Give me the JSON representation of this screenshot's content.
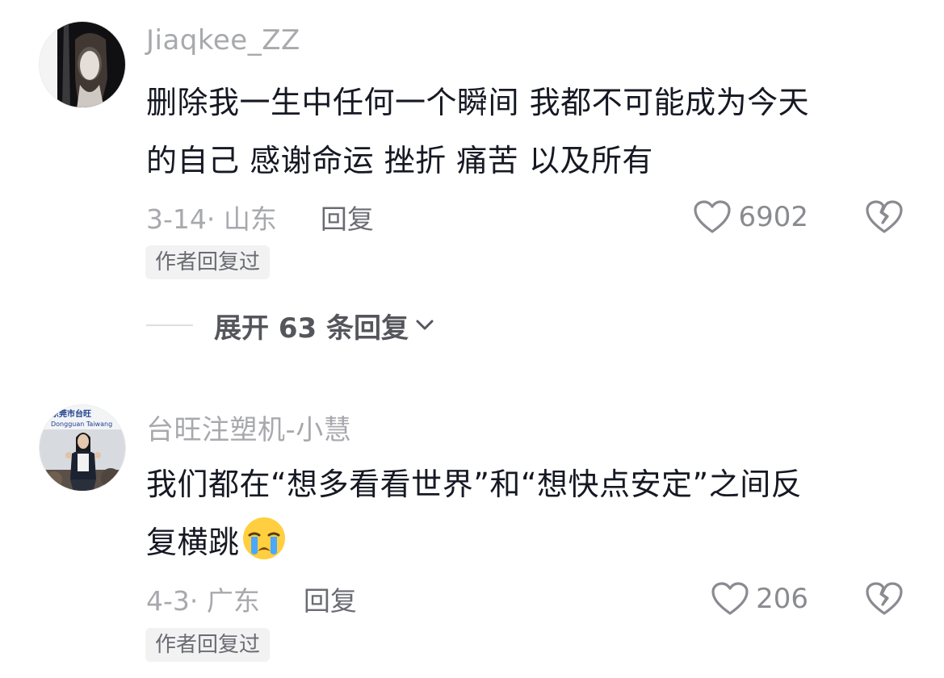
{
  "comments": [
    {
      "username": "Jiaqkee_ZZ",
      "text_line1": "删除我一生中任何一个瞬间 我都不可能成为今天",
      "text_line2": "的自己 感谢命运 挫折 痛苦 以及所有",
      "date_location": "3-14· 山东",
      "reply_label": "回复",
      "likes": "6902",
      "author_badge": "作者回复过",
      "expand_label": "展开 63 条回复"
    },
    {
      "username": "台旺注塑机-小慧",
      "avatar_sign_text": "东莞市台旺 Dongguan Taiwang",
      "text_line1": "我们都在“想多看看世界”和“想快点安定”之间反",
      "text_line2": "复横跳",
      "emoji": "crying-face",
      "date_location": "4-3· 广东",
      "reply_label": "回复",
      "likes": "206",
      "author_badge": "作者回复过"
    }
  ],
  "icons": {
    "like": "heart-outline-icon",
    "dislike": "broken-heart-icon",
    "expand": "chevron-down-icon"
  },
  "colors": {
    "text_primary": "#161823",
    "text_secondary": "#a8a9ad",
    "text_action": "#6b6c73",
    "badge_bg": "#f2f2f3"
  }
}
